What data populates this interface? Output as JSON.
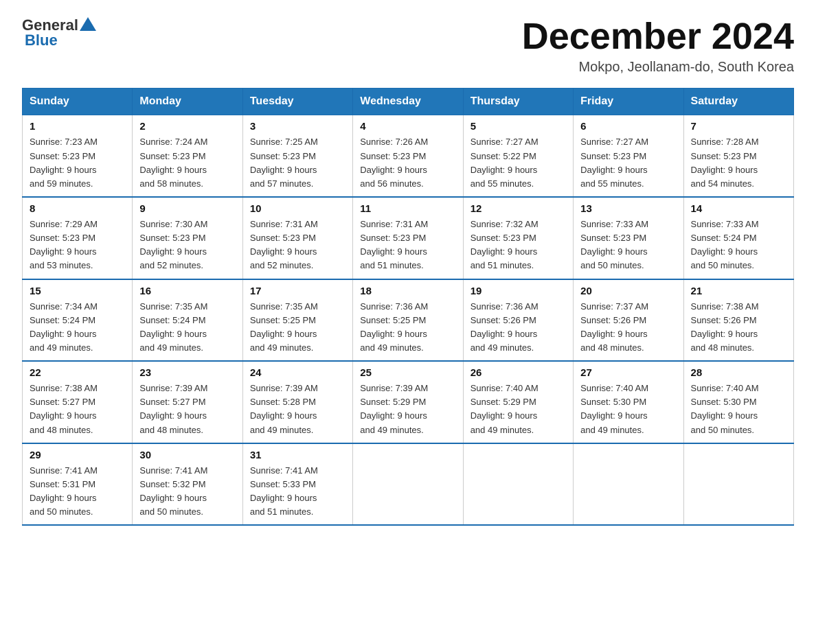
{
  "logo": {
    "general": "General",
    "blue": "Blue"
  },
  "header": {
    "month": "December 2024",
    "location": "Mokpo, Jeollanam-do, South Korea"
  },
  "weekdays": [
    "Sunday",
    "Monday",
    "Tuesday",
    "Wednesday",
    "Thursday",
    "Friday",
    "Saturday"
  ],
  "weeks": [
    [
      {
        "day": "1",
        "info": "Sunrise: 7:23 AM\nSunset: 5:23 PM\nDaylight: 9 hours\nand 59 minutes."
      },
      {
        "day": "2",
        "info": "Sunrise: 7:24 AM\nSunset: 5:23 PM\nDaylight: 9 hours\nand 58 minutes."
      },
      {
        "day": "3",
        "info": "Sunrise: 7:25 AM\nSunset: 5:23 PM\nDaylight: 9 hours\nand 57 minutes."
      },
      {
        "day": "4",
        "info": "Sunrise: 7:26 AM\nSunset: 5:23 PM\nDaylight: 9 hours\nand 56 minutes."
      },
      {
        "day": "5",
        "info": "Sunrise: 7:27 AM\nSunset: 5:22 PM\nDaylight: 9 hours\nand 55 minutes."
      },
      {
        "day": "6",
        "info": "Sunrise: 7:27 AM\nSunset: 5:23 PM\nDaylight: 9 hours\nand 55 minutes."
      },
      {
        "day": "7",
        "info": "Sunrise: 7:28 AM\nSunset: 5:23 PM\nDaylight: 9 hours\nand 54 minutes."
      }
    ],
    [
      {
        "day": "8",
        "info": "Sunrise: 7:29 AM\nSunset: 5:23 PM\nDaylight: 9 hours\nand 53 minutes."
      },
      {
        "day": "9",
        "info": "Sunrise: 7:30 AM\nSunset: 5:23 PM\nDaylight: 9 hours\nand 52 minutes."
      },
      {
        "day": "10",
        "info": "Sunrise: 7:31 AM\nSunset: 5:23 PM\nDaylight: 9 hours\nand 52 minutes."
      },
      {
        "day": "11",
        "info": "Sunrise: 7:31 AM\nSunset: 5:23 PM\nDaylight: 9 hours\nand 51 minutes."
      },
      {
        "day": "12",
        "info": "Sunrise: 7:32 AM\nSunset: 5:23 PM\nDaylight: 9 hours\nand 51 minutes."
      },
      {
        "day": "13",
        "info": "Sunrise: 7:33 AM\nSunset: 5:23 PM\nDaylight: 9 hours\nand 50 minutes."
      },
      {
        "day": "14",
        "info": "Sunrise: 7:33 AM\nSunset: 5:24 PM\nDaylight: 9 hours\nand 50 minutes."
      }
    ],
    [
      {
        "day": "15",
        "info": "Sunrise: 7:34 AM\nSunset: 5:24 PM\nDaylight: 9 hours\nand 49 minutes."
      },
      {
        "day": "16",
        "info": "Sunrise: 7:35 AM\nSunset: 5:24 PM\nDaylight: 9 hours\nand 49 minutes."
      },
      {
        "day": "17",
        "info": "Sunrise: 7:35 AM\nSunset: 5:25 PM\nDaylight: 9 hours\nand 49 minutes."
      },
      {
        "day": "18",
        "info": "Sunrise: 7:36 AM\nSunset: 5:25 PM\nDaylight: 9 hours\nand 49 minutes."
      },
      {
        "day": "19",
        "info": "Sunrise: 7:36 AM\nSunset: 5:26 PM\nDaylight: 9 hours\nand 49 minutes."
      },
      {
        "day": "20",
        "info": "Sunrise: 7:37 AM\nSunset: 5:26 PM\nDaylight: 9 hours\nand 48 minutes."
      },
      {
        "day": "21",
        "info": "Sunrise: 7:38 AM\nSunset: 5:26 PM\nDaylight: 9 hours\nand 48 minutes."
      }
    ],
    [
      {
        "day": "22",
        "info": "Sunrise: 7:38 AM\nSunset: 5:27 PM\nDaylight: 9 hours\nand 48 minutes."
      },
      {
        "day": "23",
        "info": "Sunrise: 7:39 AM\nSunset: 5:27 PM\nDaylight: 9 hours\nand 48 minutes."
      },
      {
        "day": "24",
        "info": "Sunrise: 7:39 AM\nSunset: 5:28 PM\nDaylight: 9 hours\nand 49 minutes."
      },
      {
        "day": "25",
        "info": "Sunrise: 7:39 AM\nSunset: 5:29 PM\nDaylight: 9 hours\nand 49 minutes."
      },
      {
        "day": "26",
        "info": "Sunrise: 7:40 AM\nSunset: 5:29 PM\nDaylight: 9 hours\nand 49 minutes."
      },
      {
        "day": "27",
        "info": "Sunrise: 7:40 AM\nSunset: 5:30 PM\nDaylight: 9 hours\nand 49 minutes."
      },
      {
        "day": "28",
        "info": "Sunrise: 7:40 AM\nSunset: 5:30 PM\nDaylight: 9 hours\nand 50 minutes."
      }
    ],
    [
      {
        "day": "29",
        "info": "Sunrise: 7:41 AM\nSunset: 5:31 PM\nDaylight: 9 hours\nand 50 minutes."
      },
      {
        "day": "30",
        "info": "Sunrise: 7:41 AM\nSunset: 5:32 PM\nDaylight: 9 hours\nand 50 minutes."
      },
      {
        "day": "31",
        "info": "Sunrise: 7:41 AM\nSunset: 5:33 PM\nDaylight: 9 hours\nand 51 minutes."
      },
      {
        "day": "",
        "info": ""
      },
      {
        "day": "",
        "info": ""
      },
      {
        "day": "",
        "info": ""
      },
      {
        "day": "",
        "info": ""
      }
    ]
  ]
}
